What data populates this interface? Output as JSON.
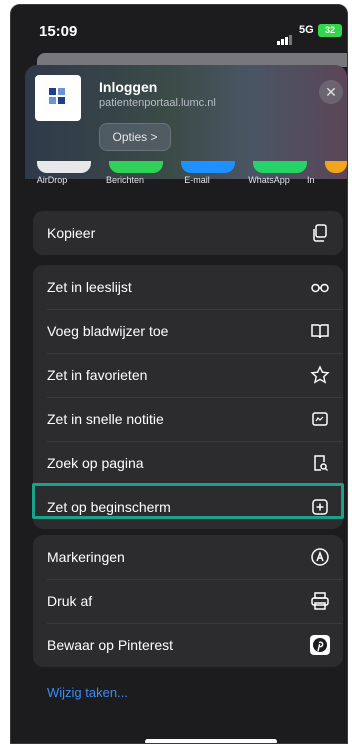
{
  "status": {
    "time": "15:09",
    "network": "5G",
    "battery": "32"
  },
  "header": {
    "title": "Inloggen",
    "url": "patientenportaal.lumc.nl",
    "options_label": "Opties >",
    "close_icon": "close-icon"
  },
  "apps": [
    {
      "label": "AirDrop",
      "color": "#e8e8ea"
    },
    {
      "label": "Berichten",
      "color": "#30d158"
    },
    {
      "label": "E-mail",
      "color": "#1e90ff"
    },
    {
      "label": "WhatsApp",
      "color": "#25d366"
    },
    {
      "label": "In",
      "color": "#f2a51a"
    }
  ],
  "groups": [
    [
      {
        "label": "Kopieer",
        "icon": "copy-icon"
      }
    ],
    [
      {
        "label": "Zet in leeslijst",
        "icon": "glasses-icon"
      },
      {
        "label": "Voeg bladwijzer toe",
        "icon": "book-icon"
      },
      {
        "label": "Zet in favorieten",
        "icon": "star-icon"
      },
      {
        "label": "Zet in snelle notitie",
        "icon": "quick-note-icon"
      },
      {
        "label": "Zoek op pagina",
        "icon": "find-on-page-icon"
      },
      {
        "label": "Zet op beginscherm",
        "icon": "add-square-icon"
      }
    ],
    [
      {
        "label": "Markeringen",
        "icon": "markup-icon"
      },
      {
        "label": "Druk af",
        "icon": "print-icon"
      },
      {
        "label": "Bewaar op Pinterest",
        "icon": "pinterest-icon"
      }
    ]
  ],
  "footer": {
    "edit_label": "Wijzig taken..."
  },
  "colors": {
    "highlight": "#1aa38a",
    "link": "#3b8cf5",
    "row_bg": "#2c2c2e"
  }
}
